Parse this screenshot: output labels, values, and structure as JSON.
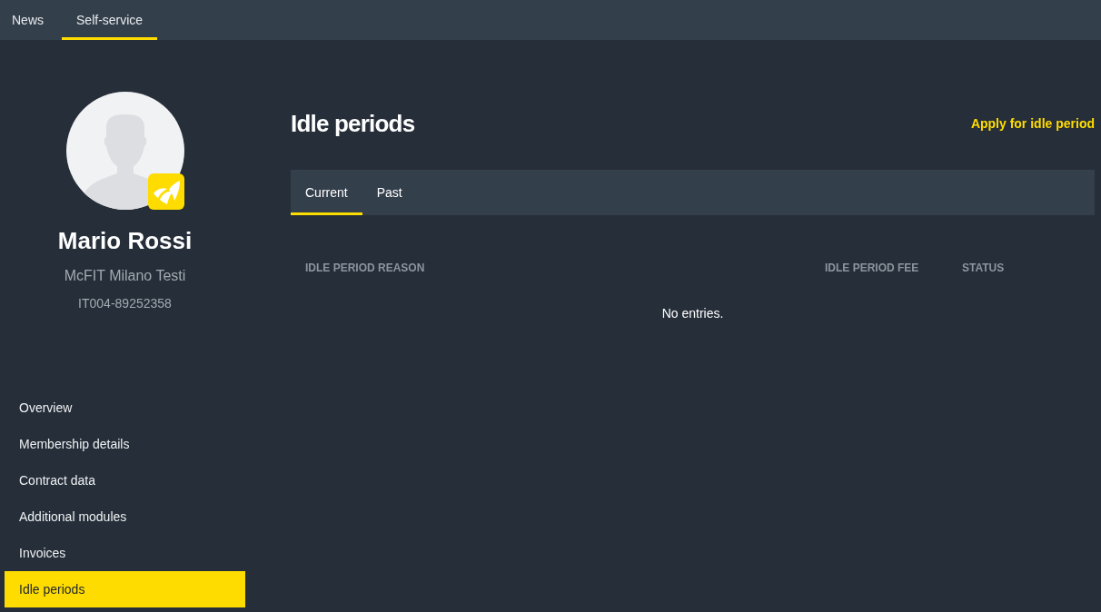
{
  "top_nav": {
    "tabs": [
      {
        "label": "News",
        "selected": false
      },
      {
        "label": "Self-service",
        "selected": true
      }
    ]
  },
  "profile": {
    "name": "Mario Rossi",
    "studio": "McFIT Milano Testi",
    "member_id": "IT004-89252358"
  },
  "sidebar": {
    "items": [
      {
        "label": "Overview",
        "selected": false
      },
      {
        "label": "Membership details",
        "selected": false
      },
      {
        "label": "Contract data",
        "selected": false
      },
      {
        "label": "Additional modules",
        "selected": false
      },
      {
        "label": "Invoices",
        "selected": false
      },
      {
        "label": "Idle periods",
        "selected": true
      }
    ]
  },
  "main": {
    "title": "Idle periods",
    "action": "Apply for idle period",
    "tabs": [
      {
        "label": "Current",
        "selected": true
      },
      {
        "label": "Past",
        "selected": false
      }
    ],
    "table": {
      "columns": [
        "IDLE PERIOD REASON",
        "IDLE PERIOD FEE",
        "STATUS"
      ],
      "empty_message": "No entries."
    }
  }
}
